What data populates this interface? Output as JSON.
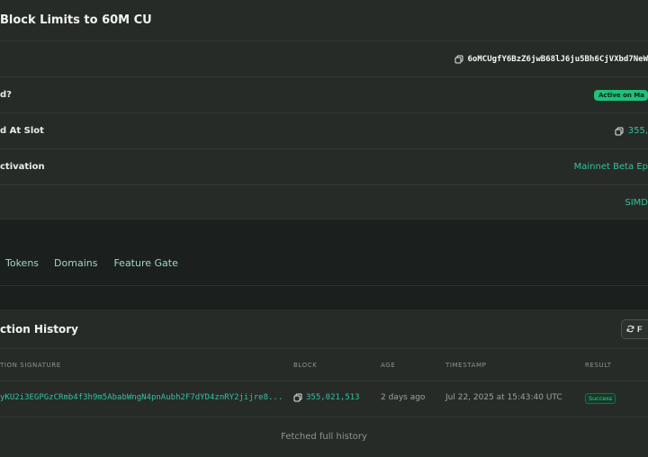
{
  "feature": {
    "title": "Block Limits to 60M CU",
    "rows": [
      {
        "label": "",
        "value": "6oMCUgfY6BzZ6jwB68lJ6ju5Bh6CjVXbd7NeW"
      },
      {
        "label": "d?",
        "value": "Active on Ma"
      },
      {
        "label": "d At Slot",
        "value": "355,"
      },
      {
        "label": "ctivation",
        "value": "Mainnet Beta Ep"
      },
      {
        "label": "",
        "value": "SIMD"
      }
    ]
  },
  "tabs": [
    {
      "label": "Tokens"
    },
    {
      "label": "Domains"
    },
    {
      "label": "Feature Gate"
    }
  ],
  "history": {
    "title": "ction History",
    "refresh_label": "F",
    "columns": {
      "signature": "TION SIGNATURE",
      "block": "BLOCK",
      "age": "AGE",
      "timestamp": "TIMESTAMP",
      "result": "RESULT"
    },
    "rows": [
      {
        "signature": "yKU2i3EGPGzCRmb4f3h9m5AbabWngN4pnAubh2F7dYD4znRY2jijre8...",
        "block": "355,021,513",
        "age": "2 days ago",
        "timestamp": "Jul 22, 2025 at 15:43:40 UTC",
        "result": "Success"
      }
    ],
    "footer": "Fetched full history"
  },
  "colors": {
    "accent_teal": "#33c29a",
    "active_green": "#1ec07a",
    "card_bg": "#262b28",
    "page_bg": "#1b1f1d"
  }
}
